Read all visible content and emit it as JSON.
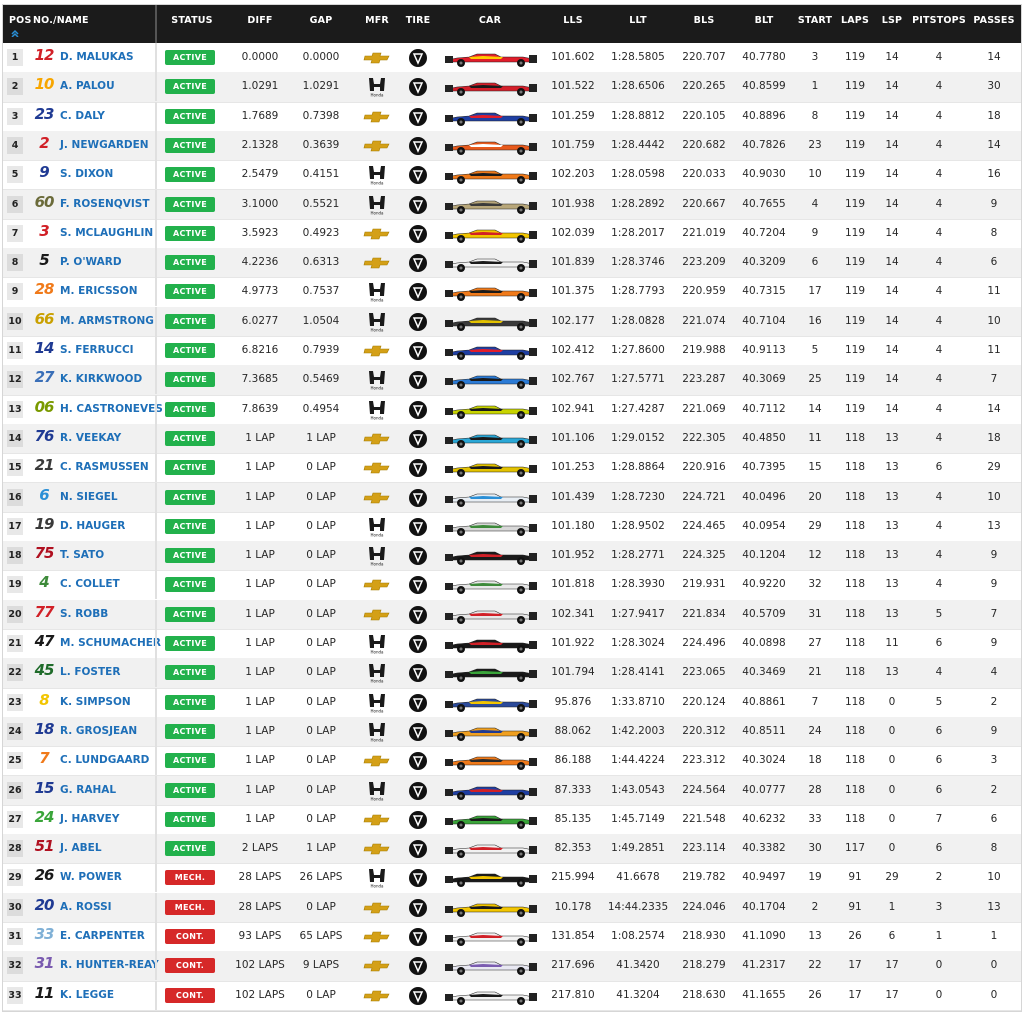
{
  "columns": {
    "pos": "POS",
    "name": "NO./NAME",
    "status": "STATUS",
    "diff": "DIFF",
    "gap": "GAP",
    "mfr": "MFR",
    "tire": "TIRE",
    "car": "CAR",
    "lls": "LLS",
    "llt": "LLT",
    "bls": "BLS",
    "blt": "BLT",
    "start": "START",
    "laps": "LAPS",
    "lsp": "LSP",
    "pitstops": "PITSTOPS",
    "passes": "PASSES"
  },
  "colors": {
    "header_bg": "#1b1b1b",
    "active": "#22b14c",
    "mech": "#d62828",
    "cont": "#d62828",
    "name_link": "#1e6fb8"
  },
  "icons": {
    "sort": "sort-up-icon",
    "chevrolet": "chevrolet-logo-icon",
    "honda": "honda-logo-icon",
    "tire": "firestone-tire-icon"
  },
  "rows": [
    {
      "pos": "1",
      "num": "12",
      "num_color": "#d12027",
      "name": "D. MALUKAS",
      "status": "ACTIVE",
      "diff": "0.0000",
      "gap": "0.0000",
      "mfr": "chevrolet",
      "mfr_label": "",
      "lls": "101.602",
      "llt": "1:28.5805",
      "bls": "220.707",
      "blt": "40.7780",
      "start": "3",
      "laps": "119",
      "lsp": "14",
      "pitstops": "4",
      "passes": "14",
      "car_color": "#e11d2b",
      "car_accent": "#ffcc00"
    },
    {
      "pos": "2",
      "num": "10",
      "num_color": "#f7a600",
      "name": "A. PALOU",
      "status": "ACTIVE",
      "diff": "1.0291",
      "gap": "1.0291",
      "mfr": "honda",
      "mfr_label": "Honda",
      "lls": "101.522",
      "llt": "1:28.6506",
      "bls": "220.265",
      "blt": "40.8599",
      "start": "1",
      "laps": "119",
      "lsp": "14",
      "pitstops": "4",
      "passes": "30",
      "car_color": "#d41f2a",
      "car_accent": "#1a1a1a"
    },
    {
      "pos": "3",
      "num": "23",
      "num_color": "#1f3a93",
      "name": "C. DALY",
      "status": "ACTIVE",
      "diff": "1.7689",
      "gap": "0.7398",
      "mfr": "chevrolet",
      "mfr_label": "",
      "lls": "101.259",
      "llt": "1:28.8812",
      "bls": "220.105",
      "blt": "40.8896",
      "start": "8",
      "laps": "119",
      "lsp": "14",
      "pitstops": "4",
      "passes": "18",
      "car_color": "#1f3fa3",
      "car_accent": "#e11d2b"
    },
    {
      "pos": "4",
      "num": "2",
      "num_color": "#d12027",
      "name": "J. NEWGARDEN",
      "status": "ACTIVE",
      "diff": "2.1328",
      "gap": "0.3639",
      "mfr": "chevrolet",
      "mfr_label": "",
      "lls": "101.759",
      "llt": "1:28.4442",
      "bls": "220.682",
      "blt": "40.7826",
      "start": "23",
      "laps": "119",
      "lsp": "14",
      "pitstops": "4",
      "passes": "14",
      "car_color": "#e85a1c",
      "car_accent": "#ffffff"
    },
    {
      "pos": "5",
      "num": "9",
      "num_color": "#1f3a93",
      "name": "S. DIXON",
      "status": "ACTIVE",
      "diff": "2.5479",
      "gap": "0.4151",
      "mfr": "honda",
      "mfr_label": "Honda",
      "lls": "102.203",
      "llt": "1:28.0598",
      "bls": "220.033",
      "blt": "40.9030",
      "start": "10",
      "laps": "119",
      "lsp": "14",
      "pitstops": "4",
      "passes": "16",
      "car_color": "#f07a1a",
      "car_accent": "#1a1a1a"
    },
    {
      "pos": "6",
      "num": "60",
      "num_color": "#6b6b3a",
      "name": "F. ROSENQVIST",
      "status": "ACTIVE",
      "diff": "3.1000",
      "gap": "0.5521",
      "mfr": "honda",
      "mfr_label": "Honda",
      "lls": "101.938",
      "llt": "1:28.2892",
      "bls": "220.667",
      "blt": "40.7655",
      "start": "4",
      "laps": "119",
      "lsp": "14",
      "pitstops": "4",
      "passes": "9",
      "car_color": "#b8a77a",
      "car_accent": "#3a3a3a"
    },
    {
      "pos": "7",
      "num": "3",
      "num_color": "#d12027",
      "name": "S. MCLAUGHLIN",
      "status": "ACTIVE",
      "diff": "3.5923",
      "gap": "0.4923",
      "mfr": "chevrolet",
      "mfr_label": "",
      "lls": "102.039",
      "llt": "1:28.2017",
      "bls": "221.019",
      "blt": "40.7204",
      "start": "9",
      "laps": "119",
      "lsp": "14",
      "pitstops": "4",
      "passes": "8",
      "car_color": "#f2c500",
      "car_accent": "#d12027"
    },
    {
      "pos": "8",
      "num": "5",
      "num_color": "#1a1a1a",
      "name": "P. O'WARD",
      "status": "ACTIVE",
      "diff": "4.2236",
      "gap": "0.6313",
      "mfr": "chevrolet",
      "mfr_label": "",
      "lls": "101.839",
      "llt": "1:28.3746",
      "bls": "223.209",
      "blt": "40.3209",
      "start": "6",
      "laps": "119",
      "lsp": "14",
      "pitstops": "4",
      "passes": "6",
      "car_color": "#f2f2f2",
      "car_accent": "#1a1a1a"
    },
    {
      "pos": "9",
      "num": "28",
      "num_color": "#f07a1a",
      "name": "M. ERICSSON",
      "status": "ACTIVE",
      "diff": "4.9773",
      "gap": "0.7537",
      "mfr": "honda",
      "mfr_label": "Honda",
      "lls": "101.375",
      "llt": "1:28.7793",
      "bls": "220.959",
      "blt": "40.7315",
      "start": "17",
      "laps": "119",
      "lsp": "14",
      "pitstops": "4",
      "passes": "11",
      "car_color": "#f07a1a",
      "car_accent": "#1a1a1a"
    },
    {
      "pos": "10",
      "num": "66",
      "num_color": "#c9a000",
      "name": "M. ARMSTRONG",
      "status": "ACTIVE",
      "diff": "6.0277",
      "gap": "1.0504",
      "mfr": "honda",
      "mfr_label": "Honda",
      "lls": "102.177",
      "llt": "1:28.0828",
      "bls": "221.074",
      "blt": "40.7104",
      "start": "16",
      "laps": "119",
      "lsp": "14",
      "pitstops": "4",
      "passes": "10",
      "car_color": "#3a3a3a",
      "car_accent": "#e3c200"
    },
    {
      "pos": "11",
      "num": "14",
      "num_color": "#1f3a93",
      "name": "S. FERRUCCI",
      "status": "ACTIVE",
      "diff": "6.8216",
      "gap": "0.7939",
      "mfr": "chevrolet",
      "mfr_label": "",
      "lls": "102.412",
      "llt": "1:27.8600",
      "bls": "219.988",
      "blt": "40.9113",
      "start": "5",
      "laps": "119",
      "lsp": "14",
      "pitstops": "4",
      "passes": "11",
      "car_color": "#1f3fa3",
      "car_accent": "#e11d2b"
    },
    {
      "pos": "12",
      "num": "27",
      "num_color": "#3a6fb8",
      "name": "K. KIRKWOOD",
      "status": "ACTIVE",
      "diff": "7.3685",
      "gap": "0.5469",
      "mfr": "honda",
      "mfr_label": "Honda",
      "lls": "102.767",
      "llt": "1:27.5771",
      "bls": "223.287",
      "blt": "40.3069",
      "start": "25",
      "laps": "119",
      "lsp": "14",
      "pitstops": "4",
      "passes": "7",
      "car_color": "#2b7bd6",
      "car_accent": "#1a1a1a"
    },
    {
      "pos": "13",
      "num": "06",
      "num_color": "#7a9a00",
      "name": "H. CASTRONEVES",
      "status": "ACTIVE",
      "diff": "7.8639",
      "gap": "0.4954",
      "mfr": "honda",
      "mfr_label": "Honda",
      "lls": "102.941",
      "llt": "1:27.4287",
      "bls": "221.069",
      "blt": "40.7112",
      "start": "14",
      "laps": "119",
      "lsp": "14",
      "pitstops": "4",
      "passes": "14",
      "car_color": "#c8d400",
      "car_accent": "#1a1a1a"
    },
    {
      "pos": "14",
      "num": "76",
      "num_color": "#1f3a93",
      "name": "R. VEEKAY",
      "status": "ACTIVE",
      "diff": "1 LAP",
      "gap": "1 LAP",
      "mfr": "chevrolet",
      "mfr_label": "",
      "lls": "101.106",
      "llt": "1:29.0152",
      "bls": "222.305",
      "blt": "40.4850",
      "start": "11",
      "laps": "118",
      "lsp": "13",
      "pitstops": "4",
      "passes": "18",
      "car_color": "#2aa7d6",
      "car_accent": "#1a1a1a"
    },
    {
      "pos": "15",
      "num": "21",
      "num_color": "#3a3a3a",
      "name": "C. RASMUSSEN",
      "status": "ACTIVE",
      "diff": "1 LAP",
      "gap": "0 LAP",
      "mfr": "chevrolet",
      "mfr_label": "",
      "lls": "101.253",
      "llt": "1:28.8864",
      "bls": "220.916",
      "blt": "40.7395",
      "start": "15",
      "laps": "118",
      "lsp": "13",
      "pitstops": "6",
      "passes": "29",
      "car_color": "#e3c200",
      "car_accent": "#1a1a1a"
    },
    {
      "pos": "16",
      "num": "6",
      "num_color": "#2a8fd6",
      "name": "N. SIEGEL",
      "status": "ACTIVE",
      "diff": "1 LAP",
      "gap": "0 LAP",
      "mfr": "chevrolet",
      "mfr_label": "",
      "lls": "101.439",
      "llt": "1:28.7230",
      "bls": "224.721",
      "blt": "40.0496",
      "start": "20",
      "laps": "118",
      "lsp": "13",
      "pitstops": "4",
      "passes": "10",
      "car_color": "#e8eef4",
      "car_accent": "#2a8fd6"
    },
    {
      "pos": "17",
      "num": "19",
      "num_color": "#3a3a3a",
      "name": "D. HAUGER",
      "status": "ACTIVE",
      "diff": "1 LAP",
      "gap": "0 LAP",
      "mfr": "honda",
      "mfr_label": "Honda",
      "lls": "101.180",
      "llt": "1:28.9502",
      "bls": "224.465",
      "blt": "40.0954",
      "start": "29",
      "laps": "118",
      "lsp": "13",
      "pitstops": "4",
      "passes": "13",
      "car_color": "#d8d8d8",
      "car_accent": "#3d8a3a"
    },
    {
      "pos": "18",
      "num": "75",
      "num_color": "#b01020",
      "name": "T. SATO",
      "status": "ACTIVE",
      "diff": "1 LAP",
      "gap": "0 LAP",
      "mfr": "honda",
      "mfr_label": "Honda",
      "lls": "101.952",
      "llt": "1:28.2771",
      "bls": "224.325",
      "blt": "40.1204",
      "start": "12",
      "laps": "118",
      "lsp": "13",
      "pitstops": "4",
      "passes": "9",
      "car_color": "#1a1a1a",
      "car_accent": "#d12027"
    },
    {
      "pos": "19",
      "num": "4",
      "num_color": "#3d8a3a",
      "name": "C. COLLET",
      "status": "ACTIVE",
      "diff": "1 LAP",
      "gap": "0 LAP",
      "mfr": "chevrolet",
      "mfr_label": "",
      "lls": "101.818",
      "llt": "1:28.3930",
      "bls": "219.931",
      "blt": "40.9220",
      "start": "32",
      "laps": "118",
      "lsp": "13",
      "pitstops": "4",
      "passes": "9",
      "car_color": "#e8e8e8",
      "car_accent": "#3d8a3a"
    },
    {
      "pos": "20",
      "num": "77",
      "num_color": "#d12027",
      "name": "S. ROBB",
      "status": "ACTIVE",
      "diff": "1 LAP",
      "gap": "0 LAP",
      "mfr": "chevrolet",
      "mfr_label": "",
      "lls": "102.341",
      "llt": "1:27.9417",
      "bls": "221.834",
      "blt": "40.5709",
      "start": "31",
      "laps": "118",
      "lsp": "13",
      "pitstops": "5",
      "passes": "7",
      "car_color": "#e8e8e8",
      "car_accent": "#d12027"
    },
    {
      "pos": "21",
      "num": "47",
      "num_color": "#1a1a1a",
      "name": "M. SCHUMACHER",
      "status": "ACTIVE",
      "diff": "1 LAP",
      "gap": "0 LAP",
      "mfr": "honda",
      "mfr_label": "Honda",
      "lls": "101.922",
      "llt": "1:28.3024",
      "bls": "224.496",
      "blt": "40.0898",
      "start": "27",
      "laps": "118",
      "lsp": "11",
      "pitstops": "6",
      "passes": "9",
      "car_color": "#1a1a1a",
      "car_accent": "#d12027"
    },
    {
      "pos": "22",
      "num": "45",
      "num_color": "#1f6b2a",
      "name": "L. FOSTER",
      "status": "ACTIVE",
      "diff": "1 LAP",
      "gap": "0 LAP",
      "mfr": "honda",
      "mfr_label": "Honda",
      "lls": "101.794",
      "llt": "1:28.4141",
      "bls": "223.065",
      "blt": "40.3469",
      "start": "21",
      "laps": "118",
      "lsp": "13",
      "pitstops": "4",
      "passes": "4",
      "car_color": "#1a1a1a",
      "car_accent": "#3aa53a"
    },
    {
      "pos": "23",
      "num": "8",
      "num_color": "#f2c500",
      "name": "K. SIMPSON",
      "status": "ACTIVE",
      "diff": "1 LAP",
      "gap": "0 LAP",
      "mfr": "honda",
      "mfr_label": "Honda",
      "lls": "95.876",
      "llt": "1:33.8710",
      "bls": "220.124",
      "blt": "40.8861",
      "start": "7",
      "laps": "118",
      "lsp": "0",
      "pitstops": "5",
      "passes": "2",
      "car_color": "#2b4a9a",
      "car_accent": "#f2c500"
    },
    {
      "pos": "24",
      "num": "18",
      "num_color": "#1f3a93",
      "name": "R. GROSJEAN",
      "status": "ACTIVE",
      "diff": "1 LAP",
      "gap": "0 LAP",
      "mfr": "honda",
      "mfr_label": "Honda",
      "lls": "88.062",
      "llt": "1:42.2003",
      "bls": "220.312",
      "blt": "40.8511",
      "start": "24",
      "laps": "118",
      "lsp": "0",
      "pitstops": "6",
      "passes": "9",
      "car_color": "#f0a020",
      "car_accent": "#1f3a93"
    },
    {
      "pos": "25",
      "num": "7",
      "num_color": "#f07a1a",
      "name": "C. LUNDGAARD",
      "status": "ACTIVE",
      "diff": "1 LAP",
      "gap": "0 LAP",
      "mfr": "chevrolet",
      "mfr_label": "",
      "lls": "86.188",
      "llt": "1:44.4224",
      "bls": "223.312",
      "blt": "40.3024",
      "start": "18",
      "laps": "118",
      "lsp": "0",
      "pitstops": "6",
      "passes": "3",
      "car_color": "#f07a1a",
      "car_accent": "#2a2a2a"
    },
    {
      "pos": "26",
      "num": "15",
      "num_color": "#1f3a93",
      "name": "G. RAHAL",
      "status": "ACTIVE",
      "diff": "1 LAP",
      "gap": "0 LAP",
      "mfr": "honda",
      "mfr_label": "Honda",
      "lls": "87.333",
      "llt": "1:43.0543",
      "bls": "224.564",
      "blt": "40.0777",
      "start": "28",
      "laps": "118",
      "lsp": "0",
      "pitstops": "6",
      "passes": "2",
      "car_color": "#1f3fa3",
      "car_accent": "#d12027"
    },
    {
      "pos": "27",
      "num": "24",
      "num_color": "#3aa53a",
      "name": "J. HARVEY",
      "status": "ACTIVE",
      "diff": "1 LAP",
      "gap": "0 LAP",
      "mfr": "chevrolet",
      "mfr_label": "",
      "lls": "85.135",
      "llt": "1:45.7149",
      "bls": "221.548",
      "blt": "40.6232",
      "start": "33",
      "laps": "118",
      "lsp": "0",
      "pitstops": "7",
      "passes": "6",
      "car_color": "#3aa53a",
      "car_accent": "#1a1a1a"
    },
    {
      "pos": "28",
      "num": "51",
      "num_color": "#b01020",
      "name": "J. ABEL",
      "status": "ACTIVE",
      "diff": "2 LAPS",
      "gap": "1 LAP",
      "mfr": "chevrolet",
      "mfr_label": "",
      "lls": "82.353",
      "llt": "1:49.2851",
      "bls": "223.114",
      "blt": "40.3382",
      "start": "30",
      "laps": "117",
      "lsp": "0",
      "pitstops": "6",
      "passes": "8",
      "car_color": "#f2f2f2",
      "car_accent": "#d12027"
    },
    {
      "pos": "29",
      "num": "26",
      "num_color": "#1a1a1a",
      "name": "W. POWER",
      "status": "MECH.",
      "diff": "28 LAPS",
      "gap": "26 LAPS",
      "mfr": "honda",
      "mfr_label": "Honda",
      "lls": "215.994",
      "llt": "41.6678",
      "bls": "219.782",
      "blt": "40.9497",
      "start": "19",
      "laps": "91",
      "lsp": "29",
      "pitstops": "2",
      "passes": "10",
      "car_color": "#1a1a1a",
      "car_accent": "#f2c500"
    },
    {
      "pos": "30",
      "num": "20",
      "num_color": "#1f3a93",
      "name": "A. ROSSI",
      "status": "MECH.",
      "diff": "28 LAPS",
      "gap": "0 LAP",
      "mfr": "chevrolet",
      "mfr_label": "",
      "lls": "10.178",
      "llt": "14:44.2335",
      "bls": "224.046",
      "blt": "40.1704",
      "start": "2",
      "laps": "91",
      "lsp": "1",
      "pitstops": "3",
      "passes": "13",
      "car_color": "#f2c500",
      "car_accent": "#1a1a1a"
    },
    {
      "pos": "31",
      "num": "33",
      "num_color": "#7fb0d6",
      "name": "E. CARPENTER",
      "status": "CONT.",
      "diff": "93 LAPS",
      "gap": "65 LAPS",
      "mfr": "chevrolet",
      "mfr_label": "",
      "lls": "131.854",
      "llt": "1:08.2574",
      "bls": "218.930",
      "blt": "41.1090",
      "start": "13",
      "laps": "26",
      "lsp": "6",
      "pitstops": "1",
      "passes": "1",
      "car_color": "#f2f2f2",
      "car_accent": "#d12027"
    },
    {
      "pos": "32",
      "num": "31",
      "num_color": "#7a5bb0",
      "name": "R. HUNTER-REAY",
      "status": "CONT.",
      "diff": "102 LAPS",
      "gap": "9 LAPS",
      "mfr": "chevrolet",
      "mfr_label": "",
      "lls": "217.696",
      "llt": "41.3420",
      "bls": "218.279",
      "blt": "41.2317",
      "start": "22",
      "laps": "17",
      "lsp": "17",
      "pitstops": "0",
      "passes": "0",
      "car_color": "#e8e8f2",
      "car_accent": "#7a5bb0"
    },
    {
      "pos": "33",
      "num": "11",
      "num_color": "#1a1a1a",
      "name": "K. LEGGE",
      "status": "CONT.",
      "diff": "102 LAPS",
      "gap": "0 LAP",
      "mfr": "chevrolet",
      "mfr_label": "",
      "lls": "217.810",
      "llt": "41.3204",
      "bls": "218.630",
      "blt": "41.1655",
      "start": "26",
      "laps": "17",
      "lsp": "17",
      "pitstops": "0",
      "passes": "0",
      "car_color": "#f2f2f2",
      "car_accent": "#1a1a1a"
    }
  ]
}
